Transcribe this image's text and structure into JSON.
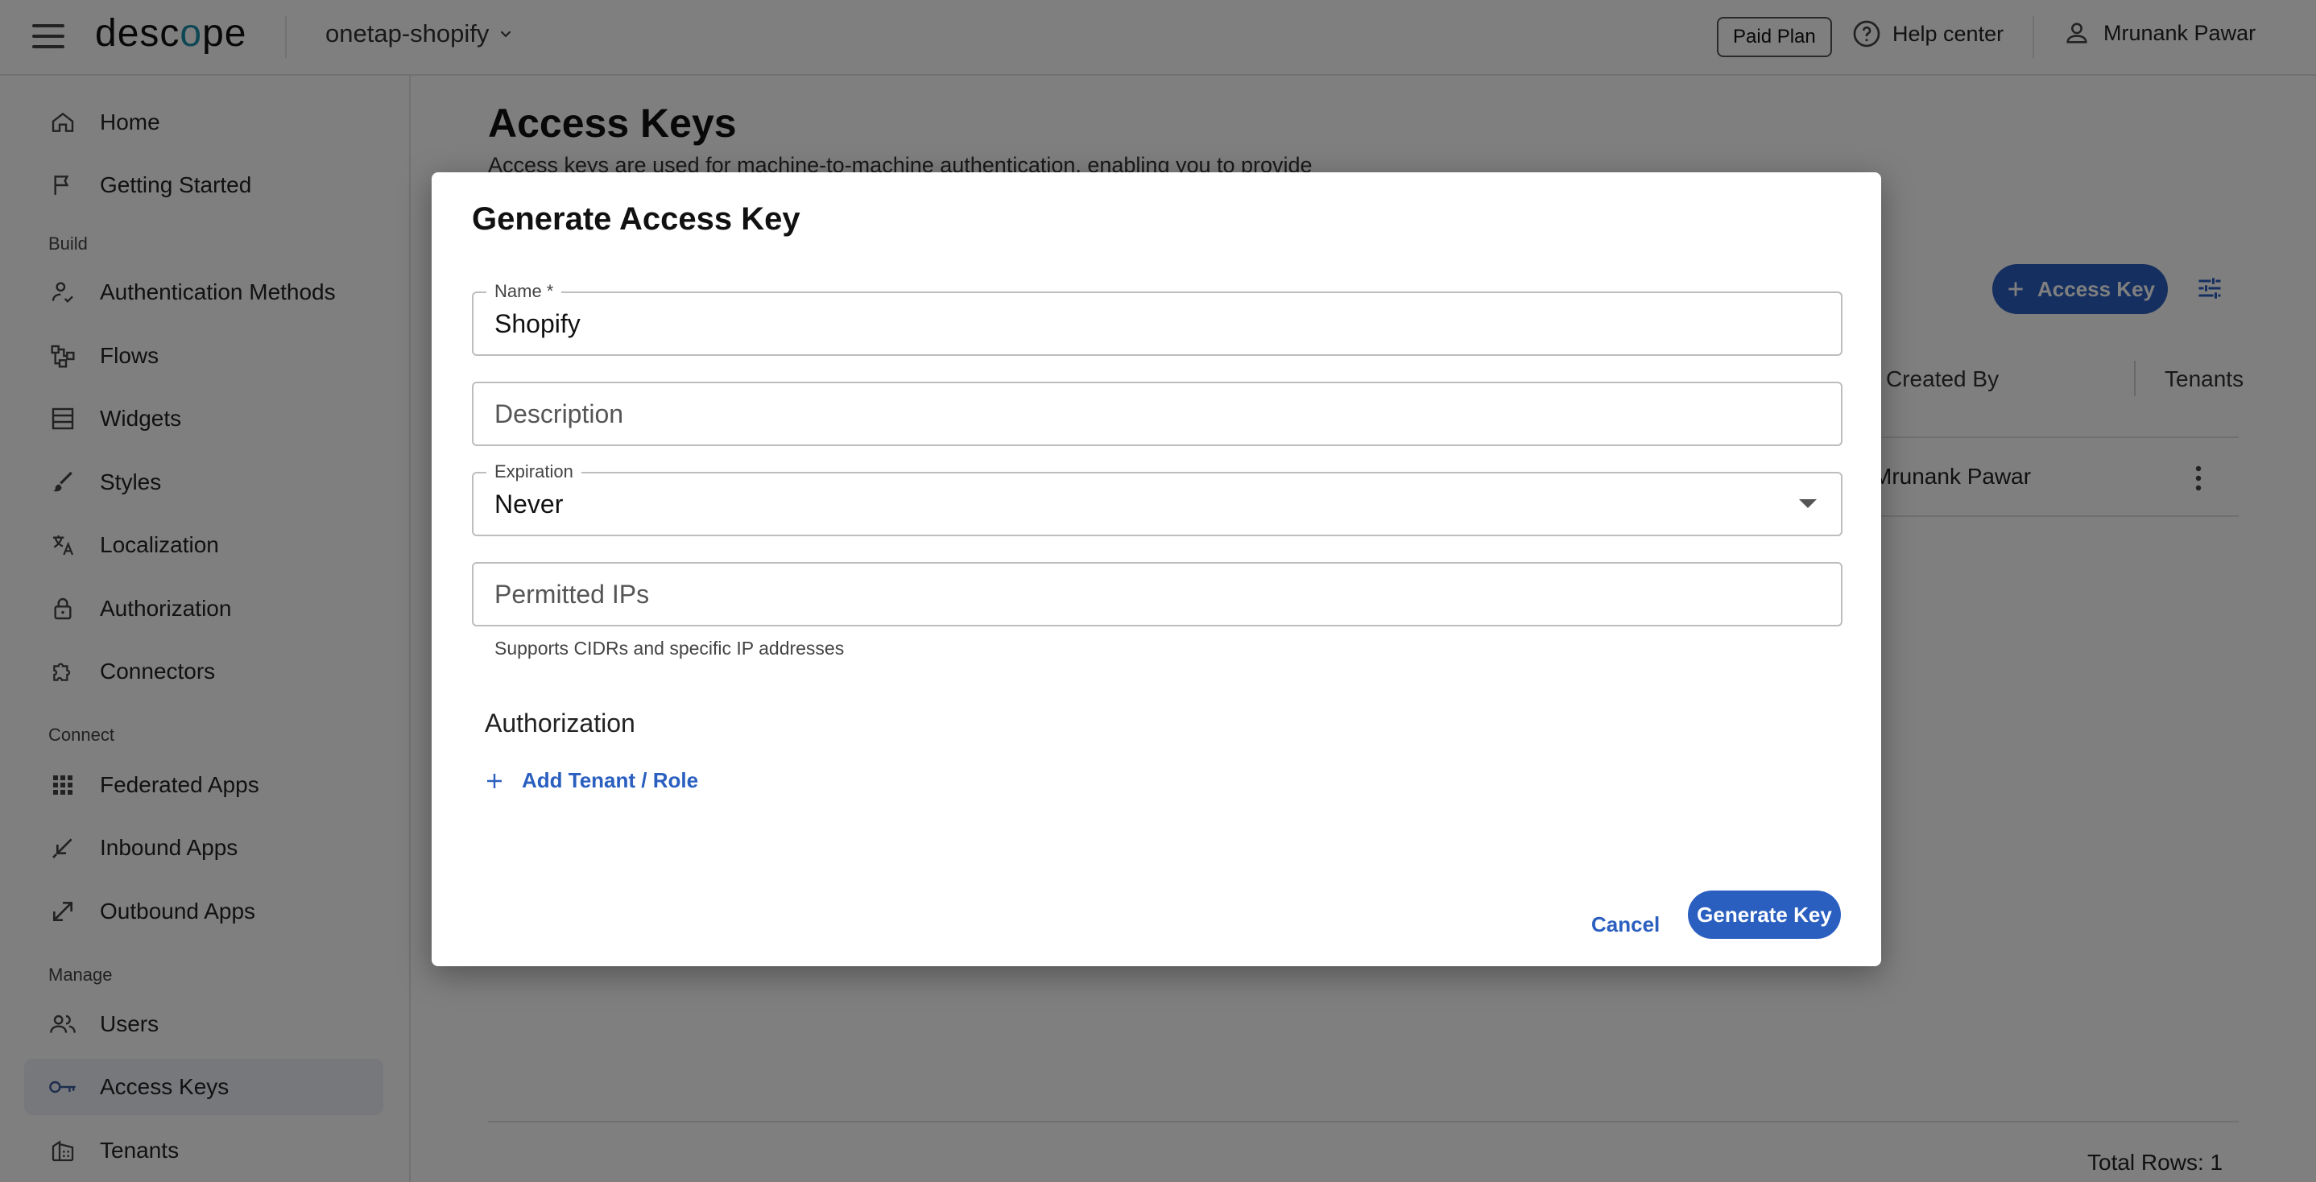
{
  "topbar": {
    "logo_prefix": "desc",
    "logo_o": "o",
    "logo_suffix": "pe",
    "project": "onetap-shopify",
    "paid_plan": "Paid Plan",
    "help": "Help center",
    "user": "Mrunank Pawar"
  },
  "sidebar": {
    "top_items": [
      {
        "label": "Home",
        "icon": "home-icon"
      },
      {
        "label": "Getting Started",
        "icon": "flag-icon"
      }
    ],
    "sections": {
      "build": "Build",
      "connect": "Connect",
      "manage": "Manage"
    },
    "build_items": [
      {
        "label": "Authentication Methods",
        "icon": "user-check-icon"
      },
      {
        "label": "Flows",
        "icon": "flow-icon"
      },
      {
        "label": "Widgets",
        "icon": "widgets-icon"
      },
      {
        "label": "Styles",
        "icon": "brush-icon"
      },
      {
        "label": "Localization",
        "icon": "translate-icon"
      },
      {
        "label": "Authorization",
        "icon": "lock-icon"
      },
      {
        "label": "Connectors",
        "icon": "puzzle-icon"
      }
    ],
    "connect_items": [
      {
        "label": "Federated Apps",
        "icon": "apps-grid-icon"
      },
      {
        "label": "Inbound Apps",
        "icon": "inbound-arrow-icon"
      },
      {
        "label": "Outbound Apps",
        "icon": "outbound-arrow-icon"
      }
    ],
    "manage_items": [
      {
        "label": "Users",
        "icon": "users-icon"
      },
      {
        "label": "Access Keys",
        "icon": "key-icon",
        "active": true
      },
      {
        "label": "Tenants",
        "icon": "building-icon"
      }
    ]
  },
  "main": {
    "title": "Access Keys",
    "subtitle": "Access keys are used for machine-to-machine authentication, enabling you to provide",
    "add_button": "Access Key",
    "columns": {
      "created_by": "Created By",
      "tenants": "Tenants"
    },
    "rows": [
      {
        "created_by": "Mrunank Pawar"
      }
    ],
    "total_rows": "Total Rows: 1"
  },
  "dialog": {
    "title": "Generate Access Key",
    "name_label": "Name *",
    "name_value": "Shopify",
    "description_placeholder": "Description",
    "expiration_label": "Expiration",
    "expiration_value": "Never",
    "ips_placeholder": "Permitted IPs",
    "ips_helper": "Supports CIDRs and specific IP addresses",
    "authorization_title": "Authorization",
    "add_tenant": "Add Tenant / Role",
    "cancel": "Cancel",
    "generate": "Generate Key"
  },
  "colors": {
    "accent": "#2a5fc0",
    "logo_o": "#1e8fa8",
    "overlay": "rgba(0,0,0,0.5)"
  }
}
